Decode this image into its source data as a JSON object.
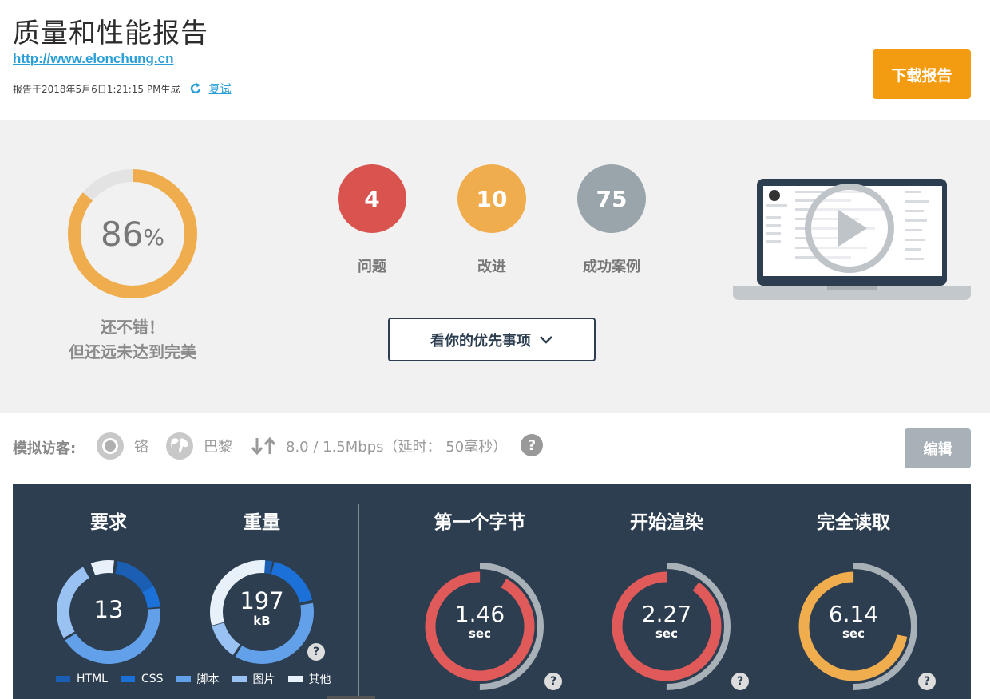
{
  "header": {
    "title": "质量和性能报告",
    "url": "http://www.elonchung.cn",
    "generated": "报告于2018年5月6日1:21:15 PM生成",
    "retest_label": "复试",
    "download_label": "下载报告"
  },
  "summary": {
    "score": "86",
    "score_unit": "%",
    "score_value": 0.86,
    "verdict_line1": "还不错！",
    "verdict_line2": "但还远未达到完美",
    "stats": [
      {
        "value": "4",
        "label": "问题",
        "color": "#d9534f"
      },
      {
        "value": "10",
        "label": "改进",
        "color": "#f0ad4e"
      },
      {
        "value": "75",
        "label": "成功案例",
        "color": "#9aa5ab"
      }
    ],
    "priorities_label": "看你的优先事项"
  },
  "visitor": {
    "label": "模拟访客:",
    "browser": "铬",
    "location": "巴黎",
    "speed": "8.0 / 1.5Mbps（延时： 50毫秒）",
    "edit_label": "编辑"
  },
  "metrics": {
    "requests": {
      "title": "要求",
      "value": "13"
    },
    "weight": {
      "title": "重量",
      "value": "197",
      "unit": "kB"
    },
    "first_byte": {
      "title": "第一个字节",
      "value": "1.46",
      "unit": "sec",
      "fraction": 0.92
    },
    "start_render": {
      "title": "开始渲染",
      "value": "2.27",
      "unit": "sec",
      "fraction": 0.9
    },
    "fully_loaded": {
      "title": "完全读取",
      "value": "6.14",
      "unit": "sec",
      "fraction": 0.72
    },
    "legend": [
      {
        "label": "HTML",
        "color": "#1a5fb4"
      },
      {
        "label": "CSS",
        "color": "#1c71d8"
      },
      {
        "label": "脚本",
        "color": "#62a0ea"
      },
      {
        "label": "图片",
        "color": "#99c1f1"
      },
      {
        "label": "其他",
        "color": "#e8f0fa"
      }
    ]
  },
  "colors": {
    "accent": "#f39c12",
    "link": "#2a9fd6",
    "dark_panel": "#2c3e50",
    "score": "#f0ad4e",
    "timing_red": "#e05a5a",
    "timing_orange": "#f0ad4e"
  }
}
